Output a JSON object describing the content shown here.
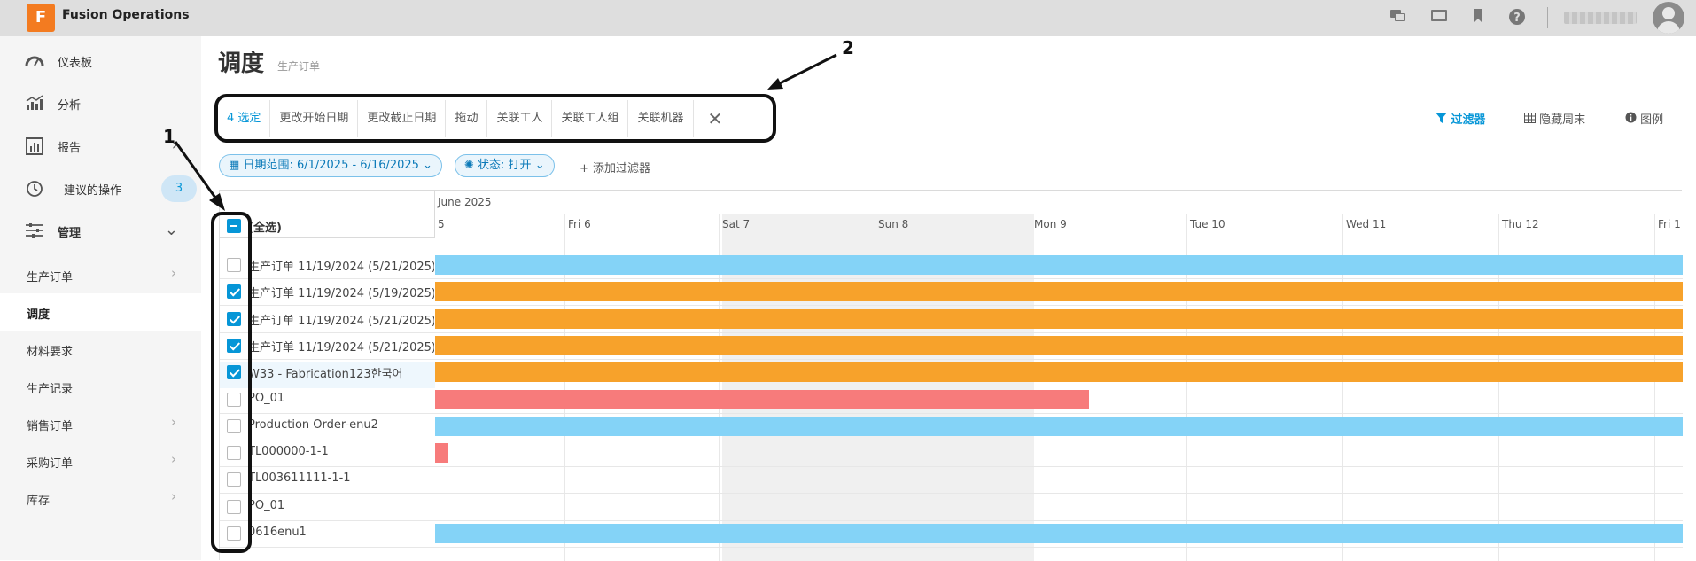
{
  "app": {
    "title": "Fusion Operations",
    "logo_letter": "F",
    "brand_color": "#f37b20",
    "accent_color": "#0696d7"
  },
  "topbar_icons": [
    "chat-icon",
    "monitor-icon",
    "bookmark-icon",
    "help-icon"
  ],
  "sidebar": {
    "top_items": [
      {
        "label": "仪表板",
        "icon": "gauge-icon"
      },
      {
        "label": "分析",
        "icon": "chart-icon"
      },
      {
        "label": "报告",
        "icon": "report-icon"
      },
      {
        "label": "建议的操作",
        "icon": "history-icon",
        "badge": "3"
      },
      {
        "label": "管理",
        "icon": "sliders-icon"
      }
    ],
    "sub_items": [
      {
        "label": "生产订单"
      },
      {
        "label": "调度"
      },
      {
        "label": "材料要求"
      },
      {
        "label": "生产记录"
      },
      {
        "label": "销售订单"
      },
      {
        "label": "采购订单"
      },
      {
        "label": "库存"
      }
    ]
  },
  "page": {
    "title": "调度",
    "subtitle": "生产订单"
  },
  "actions": {
    "selected": "4 选定",
    "change_start": "更改开始日期",
    "change_due": "更改截止日期",
    "drag": "拖动",
    "link_worker": "关联工人",
    "link_worker_group": "关联工人组",
    "link_machine": "关联机器",
    "close": "✕"
  },
  "tools": {
    "filter": "过滤器",
    "hide_weekend": "隐藏周末",
    "legend": "图例"
  },
  "filters": {
    "date_range": "日期范围: 6/1/2025 - 6/16/2025",
    "status": "状态: 打开",
    "add": "+ 添加过滤器"
  },
  "grid": {
    "select_all": "(全选)",
    "month": "June 2025",
    "days": [
      "5",
      "Fri 6",
      "Sat 7",
      "Sun 8",
      "Mon 9",
      "Tue 10",
      "Wed 11",
      "Thu 12",
      "Fri 1"
    ],
    "rows": [
      {
        "label": "生产订单 11/19/2024 (5/21/2025)",
        "checked": false,
        "bar": "blue",
        "end_fraction": 1.0
      },
      {
        "label": "生产订单 11/19/2024 (5/19/2025)",
        "checked": true,
        "bar": "orange",
        "end_fraction": 1.0
      },
      {
        "label": "生产订单 11/19/2024 (5/21/2025)",
        "checked": true,
        "bar": "orange",
        "end_fraction": 1.0
      },
      {
        "label": "生产订单 11/19/2024 (5/21/2025)",
        "checked": true,
        "bar": "orange",
        "end_fraction": 1.0
      },
      {
        "label": "W33 - Fabrication123한국어",
        "checked": true,
        "bar": "orange",
        "end_fraction": 1.0
      },
      {
        "label": "PO_01",
        "checked": false,
        "bar": "red",
        "end_fraction": 0.524
      },
      {
        "label": "Production Order-enu2",
        "checked": false,
        "bar": "blue",
        "end_fraction": 1.0
      },
      {
        "label": "TL000000-1-1",
        "checked": false,
        "bar": "red",
        "end_fraction": 0.011
      },
      {
        "label": "TL003611111-1-1",
        "checked": false,
        "bar": null,
        "end_fraction": 0
      },
      {
        "label": "PO_01",
        "checked": false,
        "bar": null,
        "end_fraction": 0
      },
      {
        "label": "0616enu1",
        "checked": false,
        "bar": "blue",
        "end_fraction": 1.0
      }
    ]
  },
  "annotations": {
    "one": "1",
    "two": "2"
  }
}
